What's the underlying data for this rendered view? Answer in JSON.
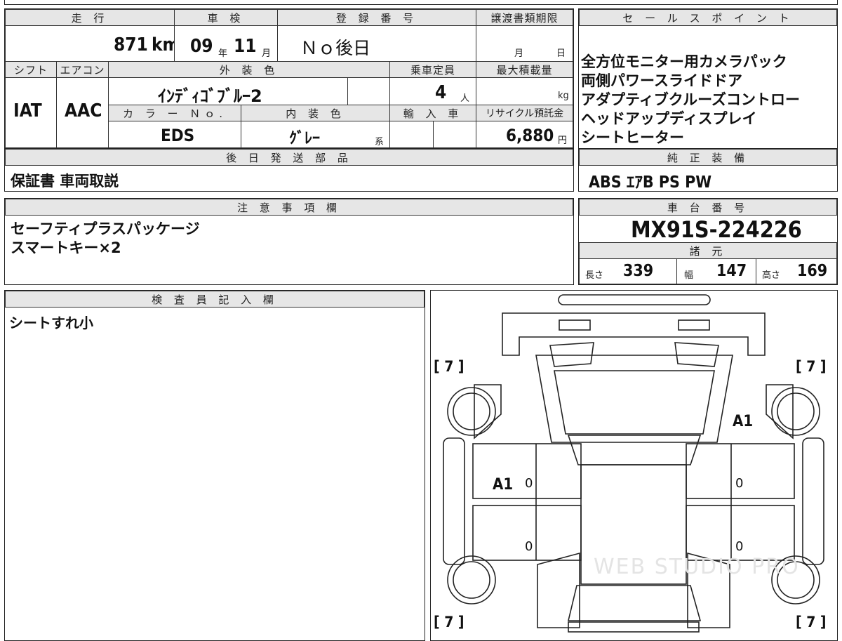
{
  "vehicle": {
    "mileage_label": "走 行",
    "mileage_value": "871",
    "mileage_unit": "km",
    "inspection_label": "車 検",
    "inspection_year": "09",
    "inspection_year_unit": "年",
    "inspection_month": "11",
    "inspection_month_unit": "月",
    "registration_label": "登 録 番 号",
    "registration_value": "Ｎｏ後日",
    "transfer_label": "譲渡書類期限",
    "transfer_month_unit": "月",
    "transfer_day_unit": "日",
    "shift_label": "シフト",
    "shift_value": "IAT",
    "ac_label": "エアコン",
    "ac_value": "AAC",
    "exterior_label": "外 装 色",
    "exterior_value": "ｲﾝﾃﾞｨｺﾞﾌﾞﾙｰ2",
    "capacity_label": "乗車定員",
    "capacity_value": "4",
    "capacity_unit": "人",
    "maxload_label": "最大積載量",
    "maxload_unit": "kg",
    "color_no_label": "カ ラ ー Ｎｏ.",
    "color_no_value": "EDS",
    "interior_label": "内 装 色",
    "interior_value": "ｸﾞﾚｰ",
    "interior_suffix": "系",
    "import_label": "輸 入 車",
    "recycle_label": "リサイクル預託金",
    "recycle_value": "6,880",
    "recycle_unit": "円"
  },
  "sales_points": {
    "label": "セ ー ル ス ポ イ ン ト",
    "items": [
      "全方位モニター用カメラパック",
      "両側パワースライドドア",
      "アダプティブクルーズコントロー",
      "ヘッドアップディスプレイ",
      "シートヒーター"
    ]
  },
  "later_parts": {
    "label": "後 日 発 送 部 品",
    "value": "保証書 車両取説"
  },
  "standard_equipment": {
    "label": "純 正 装 備",
    "value": "ABS ｴｱB PS PW"
  },
  "notes": {
    "label": "注 意 事 項 欄",
    "items": [
      "セーフティプラスパッケージ",
      "スマートキー×2"
    ]
  },
  "chassis": {
    "label": "車 台 番 号",
    "value": "MX91S-224226"
  },
  "specs": {
    "label": "諸 元",
    "length_label": "長さ",
    "length_value": "339",
    "width_label": "幅",
    "width_value": "147",
    "height_label": "高さ",
    "height_value": "169"
  },
  "inspector": {
    "label": "検 査 員 記 入 欄",
    "value": "シートすれ小"
  },
  "diagram": {
    "tire_fl": "[ 7 ]",
    "tire_fr": "[ 7 ]",
    "tire_rl": "[ 7 ]",
    "tire_rr": "[ 7 ]",
    "mark_left_door": "A1",
    "mark_right_fender": "A1",
    "zero_1": "0",
    "zero_2": "0",
    "zero_3": "0",
    "zero_4": "0",
    "watermark": "WEB STUDIO PRO"
  }
}
